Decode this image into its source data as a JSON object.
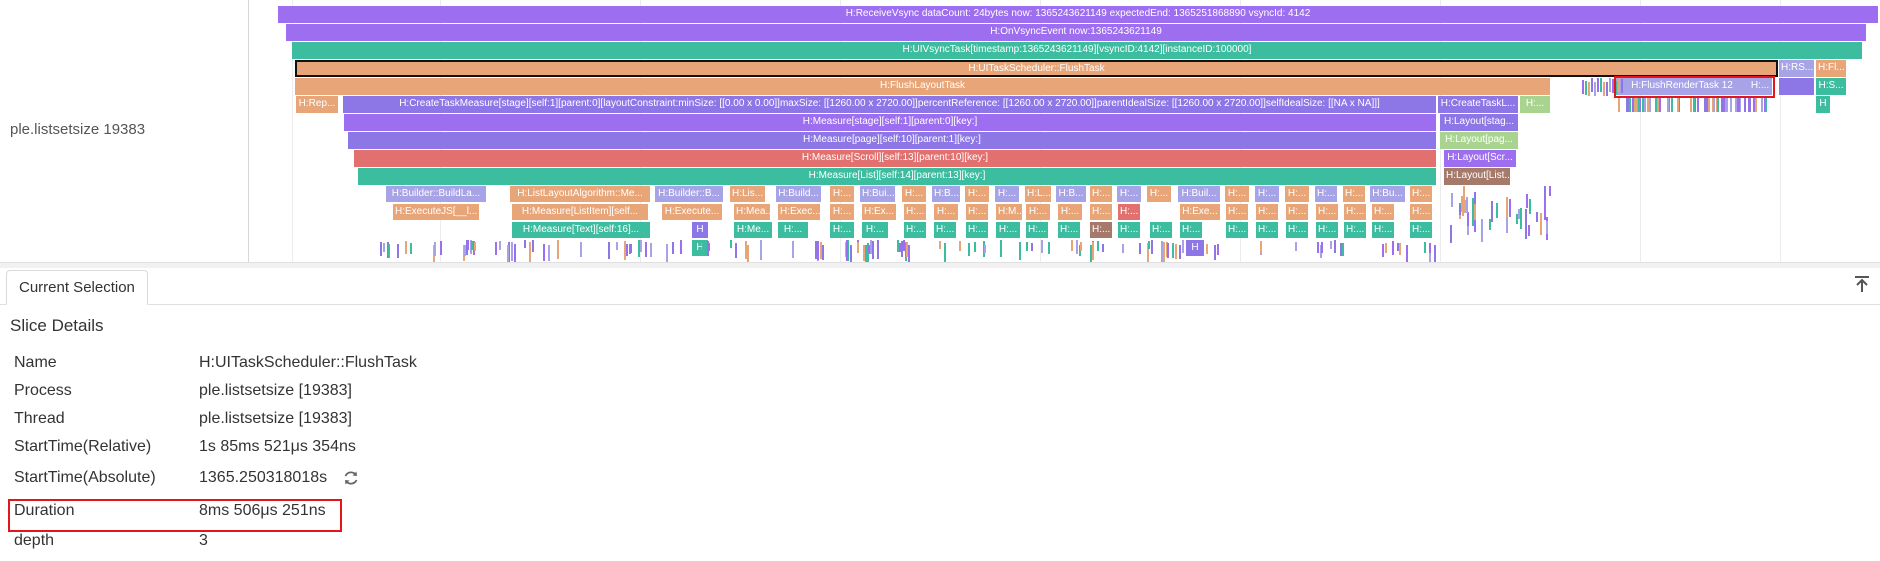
{
  "trace": {
    "process_label": "ple.listsetsize 19383",
    "colors": {
      "purple": "#9d6ef0",
      "violet": "#8d76e6",
      "teal": "#3dbd9f",
      "mint": "#7fd0b6",
      "orange": "#e8a578",
      "salmon": "#e2706e",
      "lavender": "#a6a4e6",
      "brown": "#a67a6a",
      "green": "#a9d48f",
      "highlight": "#e3161b"
    },
    "slices": {
      "receive_vsync": "H:ReceiveVsync dataCount: 24bytes now: 1365243621149 expectedEnd: 1365251868890 vsyncId: 4142",
      "on_vsync_event": "H:OnVsyncEvent now:1365243621149",
      "ui_vsync_task": "H:UIVsyncTask[timestamp:1365243621149][vsyncID:4142][instanceID:100000]",
      "ui_task_scheduler": "H:UITaskScheduler::FlushTask",
      "rs_short": "H:RS...",
      "fl_short": "H:Fl...",
      "flush_layout_task": "H:FlushLayoutTask",
      "flush_render_task": "H:FlushRenderTask 12",
      "flush_render_h": "H:...",
      "s_short": "H:S...",
      "h_short": "H",
      "rep_short": "H:Rep...",
      "create_task_measure": "H:CreateTaskMeasure[stage][self:1][parent:0][layoutConstraint:minSize: [[0.00 x 0.00]]maxSize: [[1260.00 x 2720.00]]percentReference: [[1260.00 x 2720.00]]parentIdealSize: [[1260.00 x 2720.00]]selfIdealSize: [[NA x NA]]]",
      "create_task_l": "H:CreateTaskL...",
      "h_dots": "H:...",
      "measure_stage": "H:Measure[stage][self:1][parent:0][key:]",
      "layout_stage": "H:Layout[stag...",
      "measure_page": "H:Measure[page][self:10][parent:1][key:]",
      "layout_page": "H:Layout[pag...",
      "measure_scroll": "H:Measure[Scroll][self:13][parent:10][key:]",
      "layout_scroll": "H:Layout[Scr...",
      "measure_list": "H:Measure[List][self:14][parent:13][key:]",
      "layout_list": "H:Layout[List...",
      "builder_buildla": "H:Builder::BuildLa...",
      "list_layout_algo": "H:ListLayoutAlgorithm::Me...",
      "builder_b": "H:Builder::B...",
      "lis": "H:Lis...",
      "build": "H:Build...",
      "h_colon": "H:...",
      "bui": "H:Bui...",
      "h_b": "H:B...",
      "h_l": "H:L...",
      "buil": "H:Buil...",
      "bu": "H:Bu...",
      "execute_js": "H:ExecuteJS[__l...",
      "measure_listitem": "H:Measure[ListItem][self...",
      "execute": "H:Execute...",
      "mea": "H:Mea...",
      "exec": "H:Exec...",
      "ex": "H:Ex...",
      "hm": "H:M...",
      "exe": "H:Exe...",
      "measure_text": "H:Measure[Text][self:16]...",
      "me": "H:Me...",
      "h_dot": "H:..."
    }
  },
  "tabs": {
    "current_selection": "Current Selection"
  },
  "details": {
    "title": "Slice Details",
    "rows": [
      {
        "label": "Name",
        "value": "H:UITaskScheduler::FlushTask"
      },
      {
        "label": "Process",
        "value": "ple.listsetsize [19383]"
      },
      {
        "label": "Thread",
        "value": "ple.listsetsize [19383]"
      },
      {
        "label": "StartTime(Relative)",
        "value": "1s 85ms 521μs 354ns"
      },
      {
        "label": "StartTime(Absolute)",
        "value": "1365.250318018s"
      },
      {
        "label": "Duration",
        "value": "8ms 506μs 251ns"
      },
      {
        "label": "depth",
        "value": "3"
      }
    ]
  },
  "icons": {
    "refresh": "refresh-icon",
    "pin": "pin-top-icon"
  }
}
